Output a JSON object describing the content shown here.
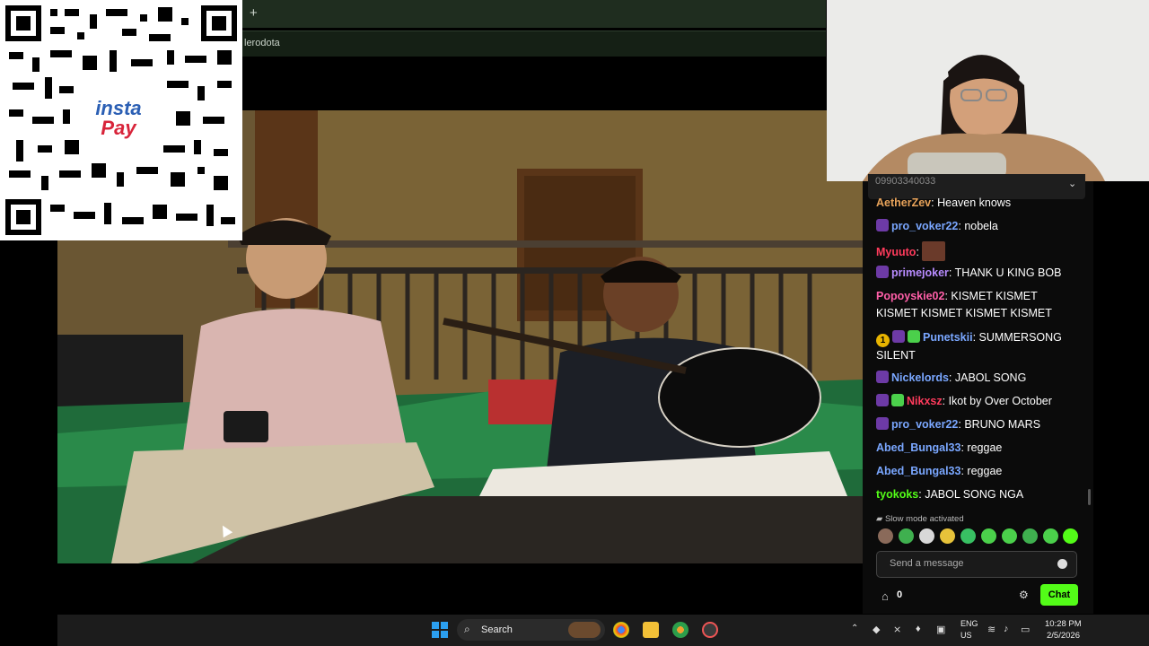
{
  "browser": {
    "new_tab_symbol": "+",
    "address_partial": "lerodota"
  },
  "qr_overlay": {
    "logo_line1": "insta",
    "logo_line2": "Pay"
  },
  "chat": {
    "pinned_partial": "09903340033",
    "messages": [
      {
        "user": "AetherZev",
        "user_color": "#e8a35a",
        "badges": [],
        "text": "Heaven knows"
      },
      {
        "user": "pro_voker22",
        "user_color": "#7aa7ff",
        "badges": [
          "prime"
        ],
        "text": "nobela"
      },
      {
        "user": "Myuuto",
        "user_color": "#ff3b5c",
        "badges": [],
        "text": "",
        "emote": "face-emote"
      },
      {
        "user": "primejoker",
        "user_color": "#b88cff",
        "badges": [
          "prime"
        ],
        "text": "THANK U KING BOB"
      },
      {
        "user": "Popoyskie02",
        "user_color": "#ff5fa8",
        "badges": [],
        "text": "KISMET KISMET KISMET KISMET KISMET KISMET"
      },
      {
        "user": "Punetskii",
        "user_color": "#7aa7ff",
        "badges": [
          "gold",
          "prime",
          "gift"
        ],
        "text": "SUMMERSONG SILENT"
      },
      {
        "user": "Nickelords",
        "user_color": "#7aa7ff",
        "badges": [
          "prime"
        ],
        "text": "JABOL SONG"
      },
      {
        "user": "Nikxsz",
        "user_color": "#ff3b5c",
        "badges": [
          "prime",
          "gift"
        ],
        "text": "Ikot by Over October"
      },
      {
        "user": "pro_voker22",
        "user_color": "#7aa7ff",
        "badges": [
          "prime"
        ],
        "text": "BRUNO MARS"
      },
      {
        "user": "Abed_Bungal33",
        "user_color": "#7aa7ff",
        "badges": [],
        "text": "reggae"
      },
      {
        "user": "Abed_Bungal33",
        "user_color": "#7aa7ff",
        "badges": [],
        "text": "reggae"
      },
      {
        "user": "tyokoks",
        "user_color": "#53fc18",
        "badges": [],
        "text": "JABOL SONG NGA"
      }
    ],
    "gold_badge_text": "1",
    "slow_mode": "Slow mode activated",
    "input_placeholder": "Send a message",
    "points": "0",
    "chat_button": "Chat"
  },
  "taskbar": {
    "search_label": "Search",
    "lang_line1": "ENG",
    "lang_line2": "US",
    "time": "10:28 PM",
    "date": "2/5/2026"
  },
  "colors": {
    "accent_green": "#53fc18",
    "chrome_green": "#1f2d1f"
  }
}
